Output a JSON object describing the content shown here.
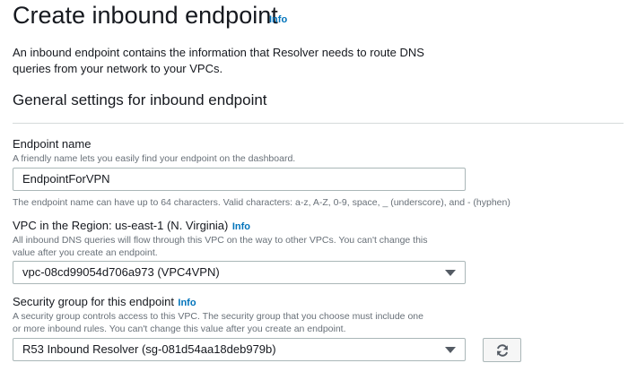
{
  "page": {
    "title": "Create inbound endpoint",
    "info_label": "Info",
    "intro": "An inbound endpoint contains the information that Resolver needs to route DNS queries from your network to your VPCs."
  },
  "section": {
    "title": "General settings for inbound endpoint"
  },
  "endpoint_name": {
    "label": "Endpoint name",
    "description": "A friendly name lets you easily find your endpoint on the dashboard.",
    "value": "EndpointForVPN",
    "constraint": "The endpoint name can have up to 64 characters. Valid characters: a-z, A-Z, 0-9, space, _ (underscore), and - (hyphen)"
  },
  "vpc": {
    "label": "VPC in the Region: us-east-1 (N. Virginia)",
    "info_label": "Info",
    "description_line1": "All inbound DNS queries will flow through this VPC on the way to other VPCs. You can't change this",
    "description_line2": "value after you create an endpoint.",
    "selected": "vpc-08cd99054d706a973 (VPC4VPN)"
  },
  "security_group": {
    "label": "Security group for this endpoint",
    "info_label": "Info",
    "description_line1": "A security group controls access to this VPC. The security group that you choose must include one",
    "description_line2": "or more inbound rules. You can't change this value after you create an endpoint.",
    "selected": "R53 Inbound Resolver (sg-081d54aa18deb979b)",
    "refresh_icon": "refresh-icon"
  }
}
